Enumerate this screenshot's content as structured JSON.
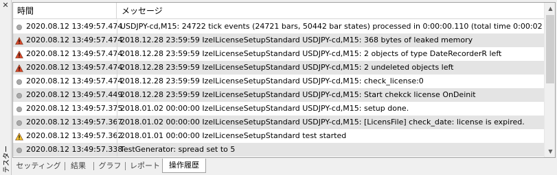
{
  "window": {
    "side_title": "テスター",
    "close_glyph": "✕"
  },
  "table": {
    "columns": [
      "時間",
      "メッセージ"
    ],
    "rows": [
      {
        "icon": "info",
        "time": "2020.08.12 13:49:57.474",
        "message": "USDJPY-cd,M15: 24722 tick events (24721 bars, 50442 bar states) processed in 0:00:00.110 (total time 0:00:02.188)"
      },
      {
        "icon": "warning-red",
        "time": "2020.08.12 13:49:57.474",
        "message": "2018.12.28 23:59:59  IzelLicenseSetupStandard USDJPY-cd,M15: 368 bytes of leaked memory"
      },
      {
        "icon": "warning-red",
        "time": "2020.08.12 13:49:57.474",
        "message": "2018.12.28 23:59:59  IzelLicenseSetupStandard USDJPY-cd,M15: 2 objects of type DateRecorderR left"
      },
      {
        "icon": "warning-red",
        "time": "2020.08.12 13:49:57.474",
        "message": "2018.12.28 23:59:59  IzelLicenseSetupStandard USDJPY-cd,M15: 2 undeleted objects left"
      },
      {
        "icon": "info",
        "time": "2020.08.12 13:49:57.474",
        "message": "2018.12.28 23:59:59  IzelLicenseSetupStandard USDJPY-cd,M15: check_license:0"
      },
      {
        "icon": "info",
        "time": "2020.08.12 13:49:57.449",
        "message": "2018.12.28 23:59:59  IzelLicenseSetupStandard USDJPY-cd,M15: Start chekck license OnDeinit"
      },
      {
        "icon": "info",
        "time": "2020.08.12 13:49:57.375",
        "message": "2018.01.02 00:00:00  IzelLicenseSetupStandard USDJPY-cd,M15: setup done."
      },
      {
        "icon": "info",
        "time": "2020.08.12 13:49:57.367",
        "message": "2018.01.02 00:00:00  IzelLicenseSetupStandard USDJPY-cd,M15: [LicensFile] check_date: license is expired."
      },
      {
        "icon": "warning-yellow",
        "time": "2020.08.12 13:49:57.362",
        "message": "2018.01.01 00:00:00  IzelLicenseSetupStandard test started"
      },
      {
        "icon": "info",
        "time": "2020.08.12 13:49:57.338",
        "message": "TestGenerator: spread set to 5"
      }
    ]
  },
  "scrollbar": {
    "up_glyph": "▲",
    "down_glyph": "▼"
  },
  "tabs": [
    {
      "label": "セッティング",
      "active": false
    },
    {
      "label": "結果",
      "active": false
    },
    {
      "label": "グラフ",
      "active": false
    },
    {
      "label": "レポート",
      "active": false
    },
    {
      "label": "操作履歴",
      "active": true
    }
  ],
  "colors": {
    "info_icon": "#a9a9a9",
    "warning_red": "#d9472b",
    "warning_yellow": "#f2c230",
    "alt_row": "#e4e4e4"
  }
}
